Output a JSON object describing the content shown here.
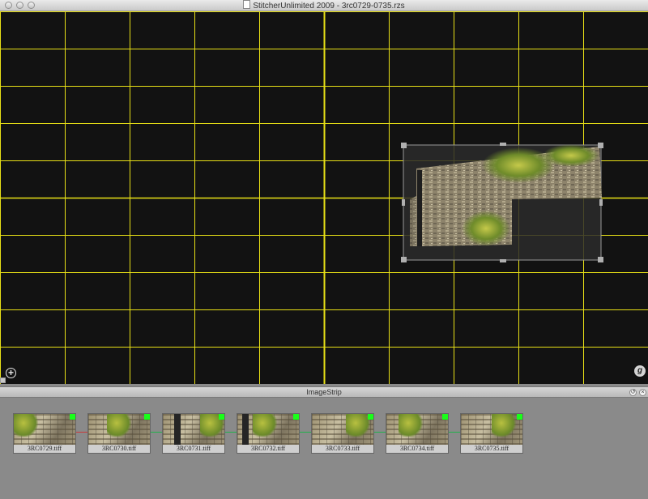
{
  "window": {
    "title": "StitcherUnlimited 2009 - 3rc0729-0735.rzs"
  },
  "canvas": {
    "background": "#121212",
    "grid_color": "#e8e016",
    "grid_columns": 10,
    "grid_rows": 10,
    "zoom_icon": "plus-circle-icon",
    "gizmo_icon": "g-circle-icon",
    "gizmo_label": "g"
  },
  "image_strip": {
    "title": "ImageStrip",
    "restore_icon": "restore-icon",
    "close_icon": "close-icon",
    "restore_glyph": "↺",
    "close_glyph": "×",
    "images": [
      {
        "label": "3RC0729.tiff",
        "selected": true
      },
      {
        "label": "3RC0730.tiff",
        "selected": true
      },
      {
        "label": "3RC0731.tiff",
        "selected": true
      },
      {
        "label": "3RC0732.tiff",
        "selected": true
      },
      {
        "label": "3RC0733.tiff",
        "selected": true
      },
      {
        "label": "3RC0734.tiff",
        "selected": true
      },
      {
        "label": "3RC0735.tiff",
        "selected": true
      }
    ]
  }
}
